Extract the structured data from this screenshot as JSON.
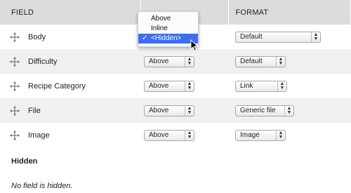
{
  "header": {
    "field": "FIELD",
    "label": "",
    "format": "FORMAT"
  },
  "rows": [
    {
      "name": "Body",
      "label": "",
      "format": "Default"
    },
    {
      "name": "Difficulty",
      "label": "Above",
      "format": "Default"
    },
    {
      "name": "Recipe Category",
      "label": "Above",
      "format": "Link"
    },
    {
      "name": "File",
      "label": "Above",
      "format": "Generic file"
    },
    {
      "name": "Image",
      "label": "Above",
      "format": "Image"
    }
  ],
  "hidden": {
    "title": "Hidden",
    "note": "No field is hidden."
  },
  "dropdown": {
    "options": [
      "Above",
      "Inline",
      "<Hidden>"
    ],
    "selected_index": 2,
    "check": "✓"
  },
  "colors": {
    "header_bg": "#dcdcdc",
    "stripe": "#f0f0ef",
    "highlight": "#3c6ef2"
  },
  "icons": {
    "drag": "move-cross-icon",
    "select": "up-down-arrows-icon",
    "cursor": "mouse-pointer-icon"
  }
}
